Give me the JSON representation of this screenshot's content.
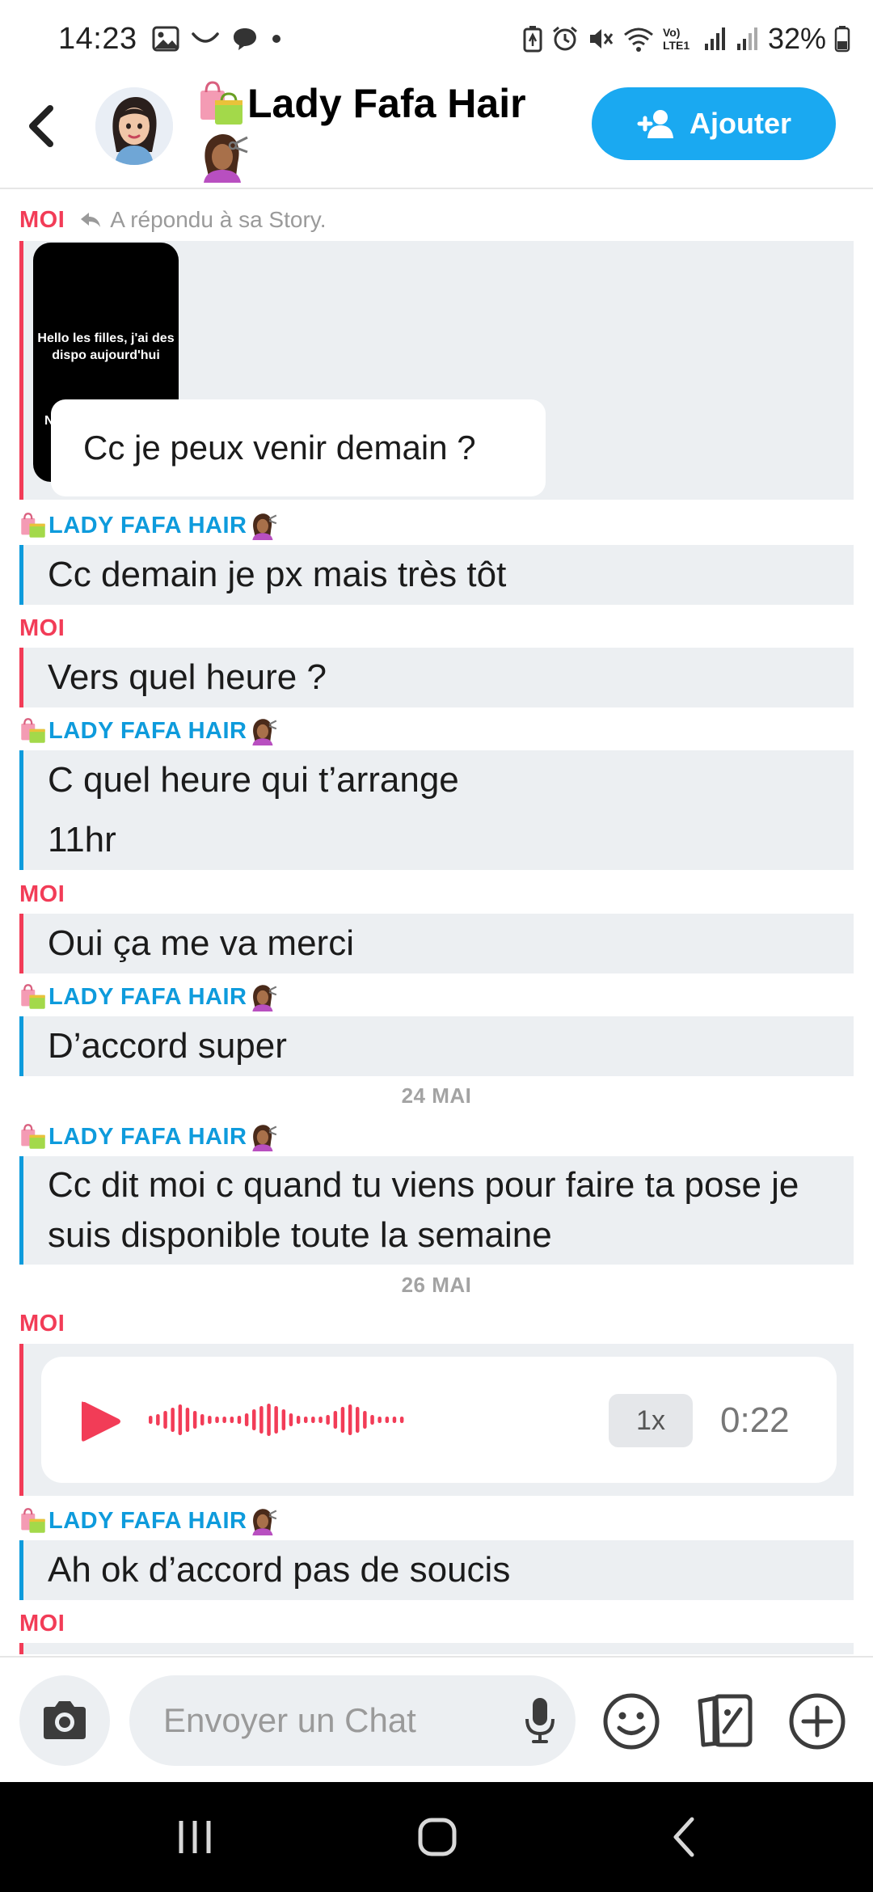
{
  "status_bar": {
    "time": "14:23",
    "battery": "32%",
    "network": "Vo) LTE1"
  },
  "header": {
    "contact_name": "Lady Fafa Hair",
    "add_label": "Ajouter"
  },
  "labels": {
    "me": "MOI",
    "her": "LADY FAFA HAIR",
    "replied_story": "A répondu à sa Story."
  },
  "story": {
    "thumb_text": "Hello les filles,  j'ai des dispo aujourd'hui",
    "thumb_partial": "N",
    "reply": "Cc je peux venir demain ?"
  },
  "messages": [
    {
      "text": "Cc demain je px mais très tôt"
    },
    {
      "text": "Vers quel heure ?"
    },
    {
      "line1": "C quel heure qui t’arrange",
      "line2": "11hr"
    },
    {
      "text": "Oui ça me va merci"
    },
    {
      "text": "D’accord super"
    },
    {
      "line1": "Cc dit moi c quand tu viens pour faire ta pose je",
      "line2": "suis disponible toute la semaine"
    },
    {
      "text": "Ah ok d’accord pas de soucis"
    }
  ],
  "dates": [
    "24 MAI",
    "26 MAI"
  ],
  "voice": {
    "speed": "1x",
    "duration": "0:22"
  },
  "input": {
    "placeholder": "Envoyer un Chat"
  },
  "colors": {
    "me": "#f23c57",
    "her": "#0e9bdc",
    "accent": "#1aa9f1"
  }
}
